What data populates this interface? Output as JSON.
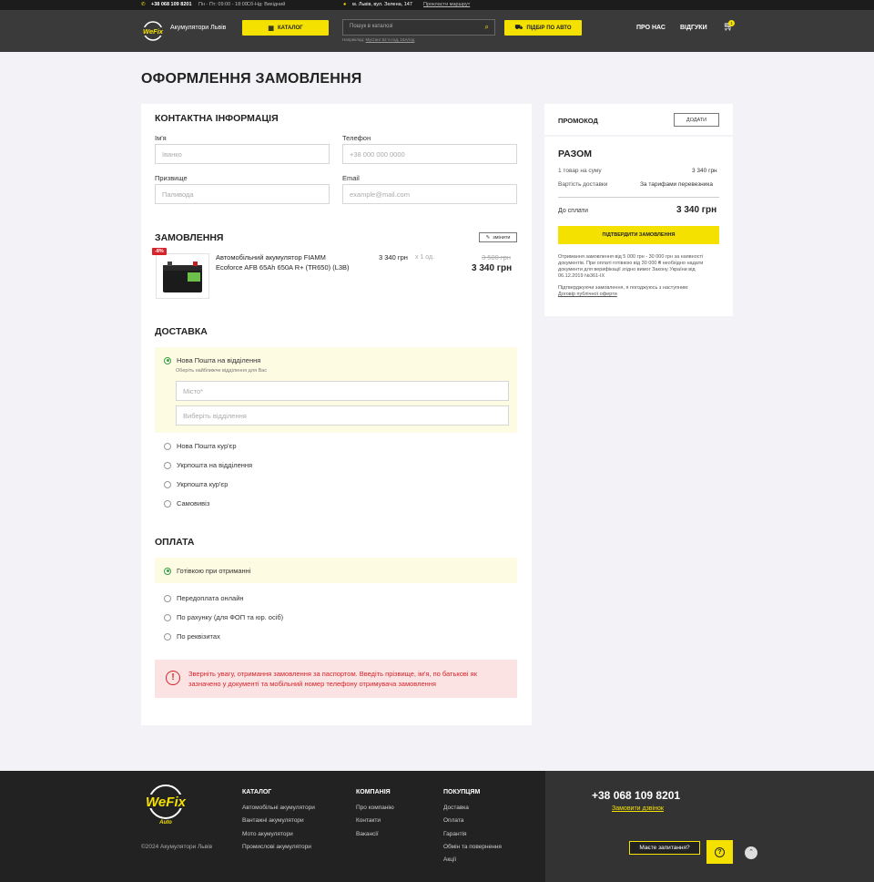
{
  "topbar": {
    "phone": "+38 068 109 8201",
    "hours": "Пн - Пт: 09:00 - 18:00",
    "weekend": "Сб-Нд: Вихідний",
    "address": "м. Львів, вул. Зелена, 147",
    "route": "Прокласти маршрут"
  },
  "header": {
    "brand": "Акумулятори Львів",
    "catalog": "КАТАЛОГ",
    "search_placeholder": "Пошук в каталозі",
    "search_hint_prefix": "Наприклад:",
    "search_hint_example": "Мустанг 62 А-год, 15А/год",
    "car_pick": "ПІДБІР ПО АВТО",
    "about": "ПРО НАС",
    "reviews": "ВІДГУКИ",
    "cart_count": "1"
  },
  "page_title": "ОФОРМЛЕННЯ ЗАМОВЛЕННЯ",
  "contact": {
    "title": "КОНТАКТНА ІНФОРМАЦІЯ",
    "name_label": "Ім'я",
    "name_placeholder": "Іванко",
    "phone_label": "Телефон",
    "phone_placeholder": "+38 000 000 0000",
    "surname_label": "Призвище",
    "surname_placeholder": "Паливода",
    "email_label": "Email",
    "email_placeholder": "example@mail.com"
  },
  "order": {
    "title": "ЗАМОВЛЕННЯ",
    "edit": "змінити",
    "discount": "-8%",
    "product_name": "Автомобільний акумулятор FIAMM Ecoforce AFB 65Ah 650A R+ (TR650) (L3B)",
    "unit_price": "3 340 грн",
    "qty": "х 1 од.",
    "old_price": "3 500 грн",
    "total": "3 340 грн"
  },
  "delivery": {
    "title": "ДОСТАВКА",
    "options": [
      "Нова Пошта на відділення",
      "Нова Пошта кур'єр",
      "Укрпошта на відділення",
      "Укрпошта кур'єр",
      "Самовивіз"
    ],
    "selected_hint": "Оберіть найближче відділення для Вас",
    "city_placeholder": "Місто*",
    "branch_placeholder": "Виберіть відділення"
  },
  "payment": {
    "title": "ОПЛАТА",
    "options": [
      "Готівкою при отриманні",
      "Передоплата онлайн",
      "По рахунку (для ФОП та юр. осіб)",
      "По реквізитах"
    ]
  },
  "alert": {
    "text": "Зверніть увагу, отримання замовлення за паспортом. Введіть прізвище, ім'я, по батькові як зазначено у документі та мобільний номер телефону отримувача замовлення"
  },
  "summary": {
    "promo_label": "ПРОМОКОД",
    "promo_button": "ДОДАТИ",
    "title": "РАЗОМ",
    "items_label": "1 товар на суму",
    "items_value": "3 340 грн",
    "delivery_label": "Вартість доставки",
    "delivery_value": "За тарифами перевезника",
    "to_pay_label": "До сплати",
    "to_pay_value": "3 340 грн",
    "confirm": "ПІДТВЕРДИТИ ЗАМОВЛЕННЯ",
    "note": "Отримання замовлення від 5 000 грн - 30 000 грн за наявності документів. При оплаті готівкою від 30 000 ₴ необхідно надати документи для верифікації згідно вимог Закону України від 06.12.2019 №361-IX",
    "agree": "Підтверджуючи замовлення, я погоджуюсь з наступним:",
    "offer_link": "Договір публічної оферти"
  },
  "footer": {
    "copyright": "©2024 Акумулятори Львів",
    "catalog_title": "КАТАЛОГ",
    "catalog_links": [
      "Автомобільні акумулятори",
      "Вантажні акумулятори",
      "Мото акумулятори",
      "Промислові акумулятори"
    ],
    "company_title": "КОМПАНІЯ",
    "company_links": [
      "Про компанію",
      "Контакти",
      "Вакансії"
    ],
    "buyers_title": "ПОКУПЦЯМ",
    "buyers_links": [
      "Доставка",
      "Оплата",
      "Гарантія",
      "Обмін та повернення",
      "Акції"
    ],
    "phone": "+38 068 109 8201",
    "callback": "Замовити дзвінок",
    "question": "Маєте запитання?"
  },
  "colors": {
    "accent": "#f5e100",
    "dark": "#222222",
    "error": "#d8232a",
    "radio_on": "#3a9e3a"
  }
}
